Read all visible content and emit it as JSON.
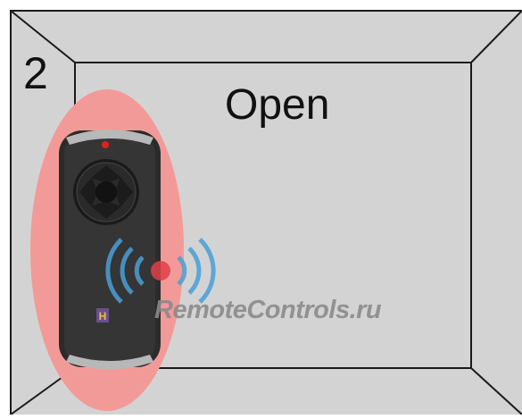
{
  "panel": {
    "step_number": "2",
    "action_label": "Open"
  },
  "remote": {
    "highlight_color": "#f29a98",
    "body_color": "#2b2b2b",
    "led_color": "#e0201e",
    "logo_letter": "H"
  },
  "watermark": {
    "text": "RemoteControls.ru",
    "signal_color": "#4a9fd6",
    "dot_color": "#e0404a"
  },
  "colors": {
    "wall": "#d3d3d3",
    "frame_line": "#1a1a1a"
  },
  "icons": [
    "remote-control-icon",
    "wireless-signal-icon"
  ]
}
